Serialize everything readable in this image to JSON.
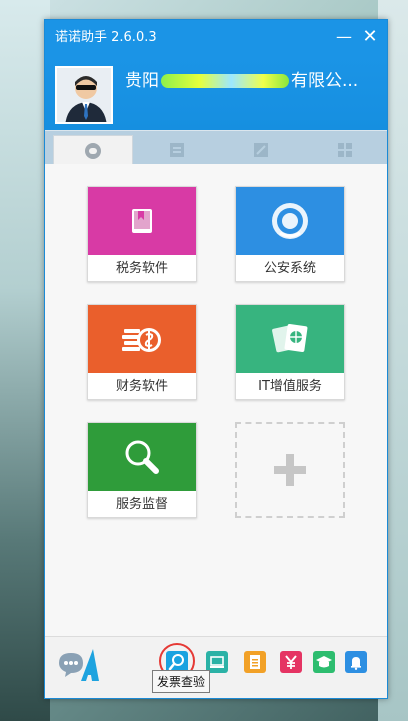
{
  "window": {
    "title": "诺诺助手 2.6.0.3",
    "min_label": "—",
    "close_label": "✕"
  },
  "user": {
    "company_prefix": "贵阳",
    "company_suffix": "有限公..."
  },
  "tabs": [
    {
      "icon": "chat-icon",
      "active": true
    },
    {
      "icon": "document-list-icon",
      "active": false
    },
    {
      "icon": "edit-board-icon",
      "active": false
    },
    {
      "icon": "grid-apps-icon",
      "active": false
    }
  ],
  "tiles": [
    {
      "label": "税务软件",
      "color": "#d83aa5"
    },
    {
      "label": "公安系统",
      "color": "#2d8fe2"
    },
    {
      "label": "财务软件",
      "color": "#ea5f2c"
    },
    {
      "label": "IT增值服务",
      "color": "#37b47f"
    },
    {
      "label": "服务监督",
      "color": "#2f9c3a"
    }
  ],
  "footer": {
    "buttons": [
      {
        "icon": "invoice-check-search-icon",
        "color": "#1aa2e0"
      },
      {
        "icon": "computer-icon",
        "color": "#2bb2a6"
      },
      {
        "icon": "document-icon",
        "color": "#f2a127"
      },
      {
        "icon": "yuan-icon",
        "color": "#e53463"
      },
      {
        "icon": "graduation-cap-icon",
        "color": "#2dbd6f"
      },
      {
        "icon": "bell-icon",
        "color": "#2d8fe2"
      }
    ],
    "tooltip": "发票查验"
  }
}
